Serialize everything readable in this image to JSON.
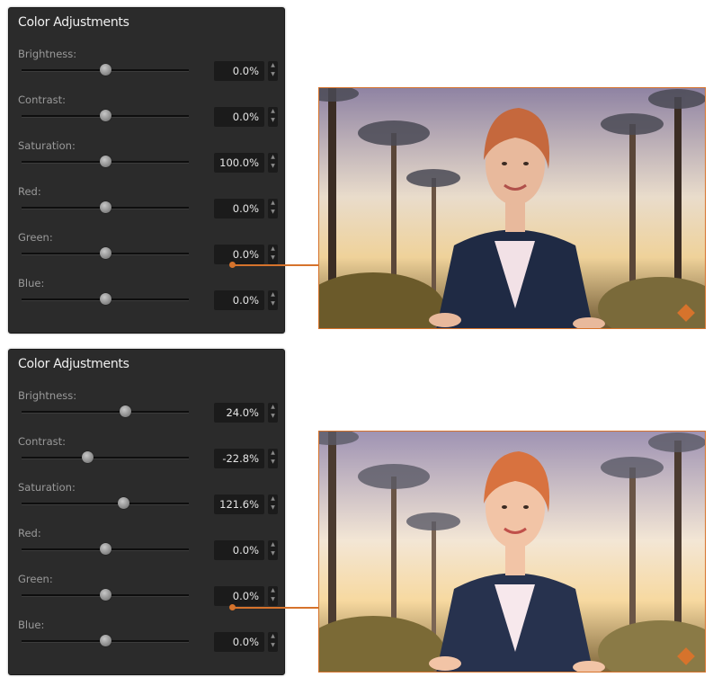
{
  "panels": [
    {
      "title": "Color Adjustments",
      "sliders": [
        {
          "label": "Brightness:",
          "value": "0.0%",
          "level": 0.5
        },
        {
          "label": "Contrast:",
          "value": "0.0%",
          "level": 0.5
        },
        {
          "label": "Saturation:",
          "value": "100.0%",
          "level": 0.5
        },
        {
          "label": "Red:",
          "value": "0.0%",
          "level": 0.5
        },
        {
          "label": "Green:",
          "value": "0.0%",
          "level": 0.5
        },
        {
          "label": "Blue:",
          "value": "0.0%",
          "level": 0.5
        }
      ]
    },
    {
      "title": "Color Adjustments",
      "sliders": [
        {
          "label": "Brightness:",
          "value": "24.0%",
          "level": 0.62
        },
        {
          "label": "Contrast:",
          "value": "-22.8%",
          "level": 0.39
        },
        {
          "label": "Saturation:",
          "value": "121.6%",
          "level": 0.61
        },
        {
          "label": "Red:",
          "value": "0.0%",
          "level": 0.5
        },
        {
          "label": "Green:",
          "value": "0.0%",
          "level": 0.5
        },
        {
          "label": "Blue:",
          "value": "0.0%",
          "level": 0.5
        }
      ]
    }
  ],
  "images": [
    {
      "name": "presenter-preview-default"
    },
    {
      "name": "presenter-preview-adjusted"
    }
  ],
  "colors": {
    "panel_bg": "#2b2b2b",
    "accent_orange": "#d6732c",
    "value_bg": "#1b1b1b"
  },
  "icons": {
    "stepper": "up-down-arrows-icon",
    "photo_badge": "warning-badge-icon"
  }
}
